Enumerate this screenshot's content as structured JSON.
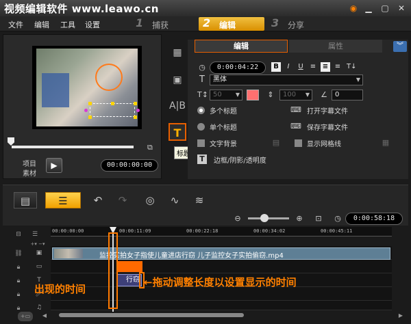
{
  "window": {
    "title": "视频编辑软件  www.leawo.cn",
    "controls": [
      "badge-icon",
      "minimize-icon",
      "maximize-icon",
      "close-icon"
    ]
  },
  "menu": [
    "文件",
    "编辑",
    "工具",
    "设置"
  ],
  "steps": [
    {
      "num": "1",
      "label": "捕获",
      "active": false
    },
    {
      "num": "2",
      "label": "编辑",
      "active": true
    },
    {
      "num": "3",
      "label": "分享",
      "active": false
    }
  ],
  "preview": {
    "project_label": "项目",
    "clip_label": "素材",
    "timecode": "00:00:00:00"
  },
  "sidetools": {
    "title_tooltip": "标题",
    "title_glyph": "T"
  },
  "options": {
    "tab_edit": "编辑",
    "tab_attr": "属性",
    "duration": "0:00:04:22",
    "font": "黑体",
    "font_size": "50",
    "line_spacing": "100",
    "angle": "0",
    "multi_title": "多个标题",
    "single_title": "单个标题",
    "text_bg": "文字背景",
    "show_grid": "显示网格线",
    "border_shadow": "边框/阴影/透明度",
    "open_subtitle": "打开字幕文件",
    "save_subtitle": "保存字幕文件",
    "color": "#ff7070",
    "accent": "#e85f00"
  },
  "timeline": {
    "total_time": "0:00:58:18",
    "ruler_ticks": [
      "00:00:00:00",
      "00:00:11:09",
      "00:00:22:18",
      "00:00:34:02",
      "00:00:45:11"
    ],
    "video_clip_name": "监控实拍女子指使儿童进店行窃 儿子监控女子实拍偷窃.mp4",
    "title_clip_text": "行窃",
    "annotation_appear": "出现的时间",
    "annotation_drag": "←拖动调整长度以设置显示的时间"
  }
}
